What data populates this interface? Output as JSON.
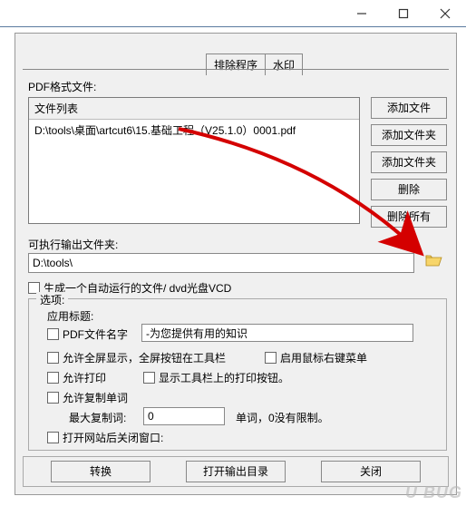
{
  "titlebar": {},
  "tabs": {
    "exclude": "排除程序",
    "watermark": "水印"
  },
  "labels": {
    "pdf_files": "PDF格式文件:",
    "file_list_header": "文件列表",
    "out_folder": "可执行输出文件夹:",
    "autorun": "生成一个自动运行的文件/ dvd光盘VCD",
    "options": "选项:",
    "app_title": "应用标题:",
    "pdf_filename": "PDF文件名字",
    "fullscreen": "允许全屏显示，全屏按钮在工具栏",
    "rightclick": "启用鼠标右键菜单",
    "allow_print": "允许打印",
    "toolbar_print": "显示工具栏上的打印按钮。",
    "allow_copyword": "允许复制单词",
    "max_copyword": "最大复制词:",
    "max_copyword_after": "单词，0没有限制。",
    "close_after_site": "打开网站后关闭窗口:"
  },
  "files": {
    "row1": "D:\\tools\\桌面\\artcut6\\15.基础工程（V25.1.0）0001.pdf"
  },
  "side_buttons": {
    "add_file": "添加文件",
    "add_folder1": "添加文件夹",
    "add_folder2": "添加文件夹",
    "delete": "删除",
    "delete_all": "删除所有"
  },
  "inputs": {
    "out_path": "D:\\tools\\",
    "pdfname_value": "-为您提供有用的知识",
    "maxcopy_value": "0"
  },
  "bottom": {
    "convert": "转换",
    "open_output": "打开输出目录",
    "close": "关闭"
  },
  "watermark": "U BUG"
}
